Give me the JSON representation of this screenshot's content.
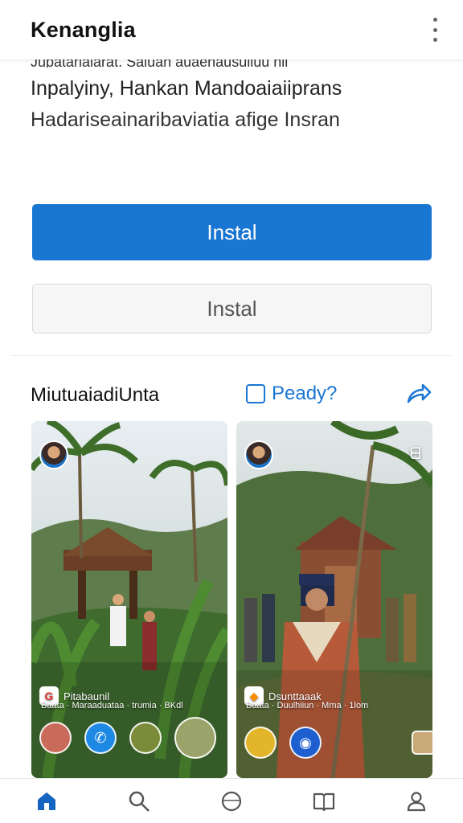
{
  "app_bar": {
    "title": "Kenanglia"
  },
  "description": {
    "cut_line": "Jupatarialarat. Saluan auaenausulluu nii",
    "line1": "Inpalyiny, Hankan Mandoaiaiiprans",
    "line2": "Hadariseainaribaviatia afige Insran"
  },
  "buttons": {
    "primary_label": "Instal",
    "secondary_label": "Instal"
  },
  "section": {
    "title": "MiutuaiadiUnta",
    "preview_label": "Peady?"
  },
  "cards": [
    {
      "overlay_label": "Pitabaunil",
      "overlay_sub": "Baata · Maraaduataa · trumia · BKdl"
    },
    {
      "overlay_label": "Dsunttaaak",
      "overlay_sub": "Baata · Duulhiiun · Mma · 1lom",
      "top_right": "ᗺ"
    }
  ],
  "icons": [
    "more-vert-icon",
    "share-icon",
    "home-icon",
    "search-icon",
    "circle-icon",
    "book-icon",
    "person-icon"
  ],
  "colors": {
    "accent": "#1976d2",
    "nav_active": "#1565c0"
  }
}
